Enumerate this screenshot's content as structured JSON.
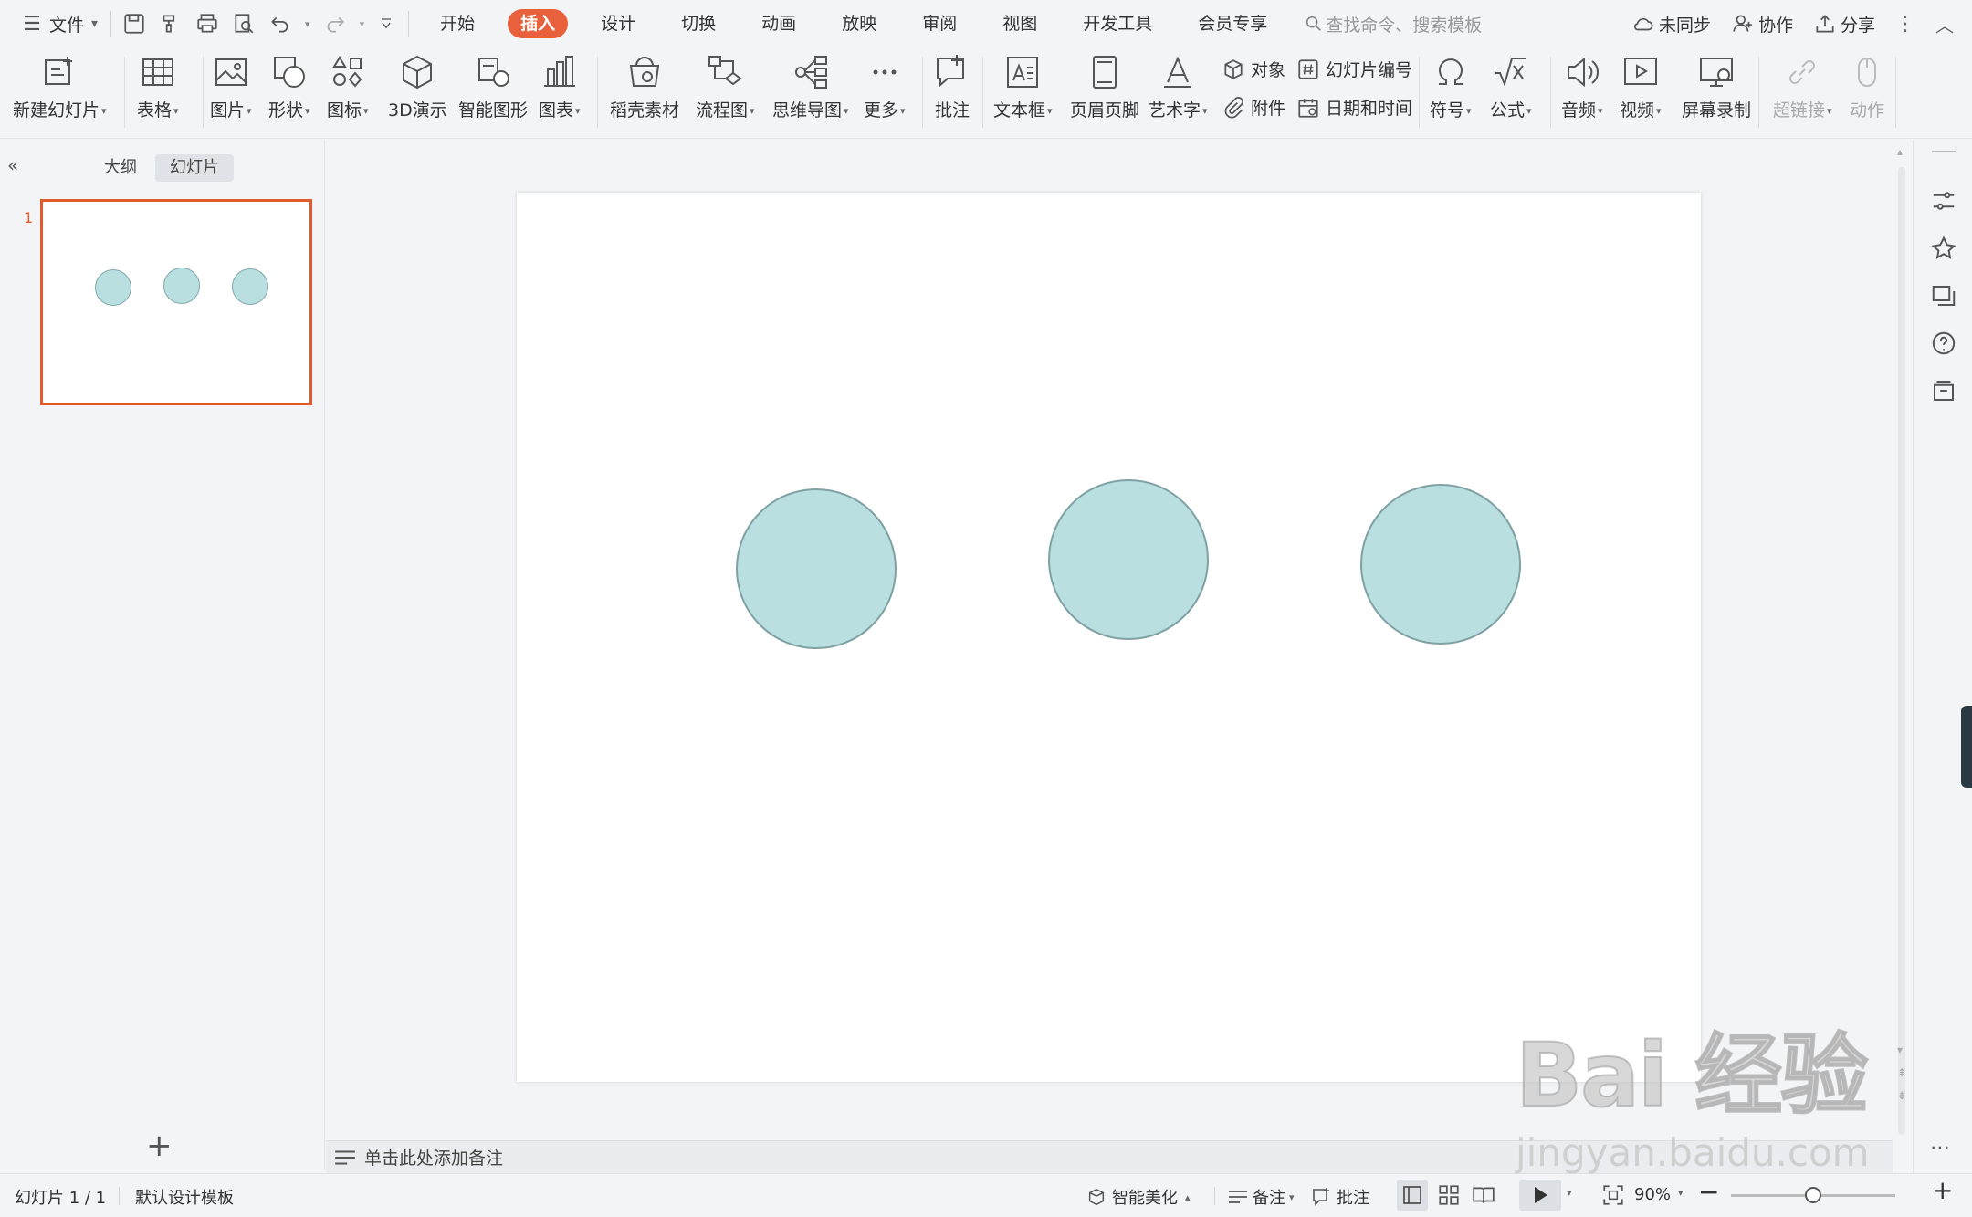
{
  "menubar": {
    "file_label": "文件",
    "tabs": [
      "开始",
      "插入",
      "设计",
      "切换",
      "动画",
      "放映",
      "审阅",
      "视图",
      "开发工具",
      "会员专享"
    ],
    "active_tab": "插入",
    "search_placeholder": "查找命令、搜索模板",
    "sync_label": "未同步",
    "collab_label": "协作",
    "share_label": "分享"
  },
  "ribbon": {
    "new_slide": "新建幻灯片",
    "table": "表格",
    "picture": "图片",
    "shape": "形状",
    "icon": "图标",
    "3d": "3D演示",
    "smart_shape": "智能图形",
    "chart": "图表",
    "docer": "稻壳素材",
    "flowchart": "流程图",
    "mindmap": "思维导图",
    "more": "更多",
    "comment": "批注",
    "textbox": "文本框",
    "header_footer": "页眉页脚",
    "wordart": "艺术字",
    "object": "对象",
    "attachment": "附件",
    "slide_number": "幻灯片编号",
    "datetime": "日期和时间",
    "symbol": "符号",
    "formula": "公式",
    "audio": "音频",
    "video": "视频",
    "screen_record": "屏幕录制",
    "hyperlink": "超链接",
    "action": "动作"
  },
  "leftpanel": {
    "tab_outline": "大纲",
    "tab_slides": "幻灯片",
    "slide_index": "1"
  },
  "notes": {
    "placeholder": "单击此处添加备注"
  },
  "statusbar": {
    "slide_info": "幻灯片 1 / 1",
    "template": "默认设计模板",
    "smart_beautify": "智能美化",
    "notes": "备注",
    "comment": "批注",
    "zoom": "90%",
    "zoom_fraction": 0.5
  },
  "watermark": {
    "logo": "Bai 经验",
    "url": "jingyan.baidu.com"
  },
  "colors": {
    "accent": "#e8603c",
    "circle_fill": "#b9dfe1",
    "circle_stroke": "#7fa1a4"
  }
}
